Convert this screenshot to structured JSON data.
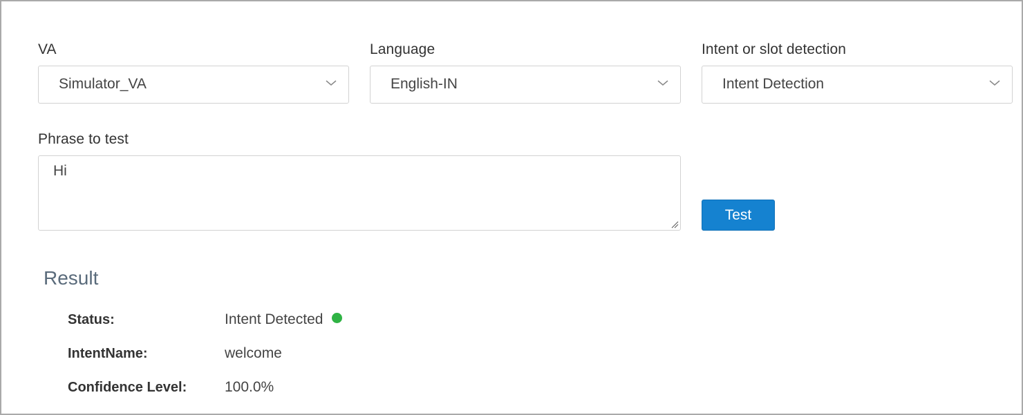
{
  "form": {
    "va": {
      "label": "VA",
      "value": "Simulator_VA"
    },
    "language": {
      "label": "Language",
      "value": "English-IN"
    },
    "detection": {
      "label": "Intent or slot detection",
      "value": "Intent Detection"
    },
    "phrase": {
      "label": "Phrase to test",
      "value": "Hi"
    },
    "test_button": "Test"
  },
  "result": {
    "title": "Result",
    "status_label": "Status:",
    "status_value": "Intent Detected",
    "status_color": "#2fb344",
    "intent_label": "IntentName:",
    "intent_value": "welcome",
    "confidence_label": "Confidence Level:",
    "confidence_value": "100.0%"
  },
  "icons": {
    "dropdown": "chevron-down-icon",
    "resize": "resize-grip-icon",
    "status": "status-dot-icon"
  },
  "colors": {
    "button": "#1582d0",
    "result_title": "#5a6b7b"
  }
}
